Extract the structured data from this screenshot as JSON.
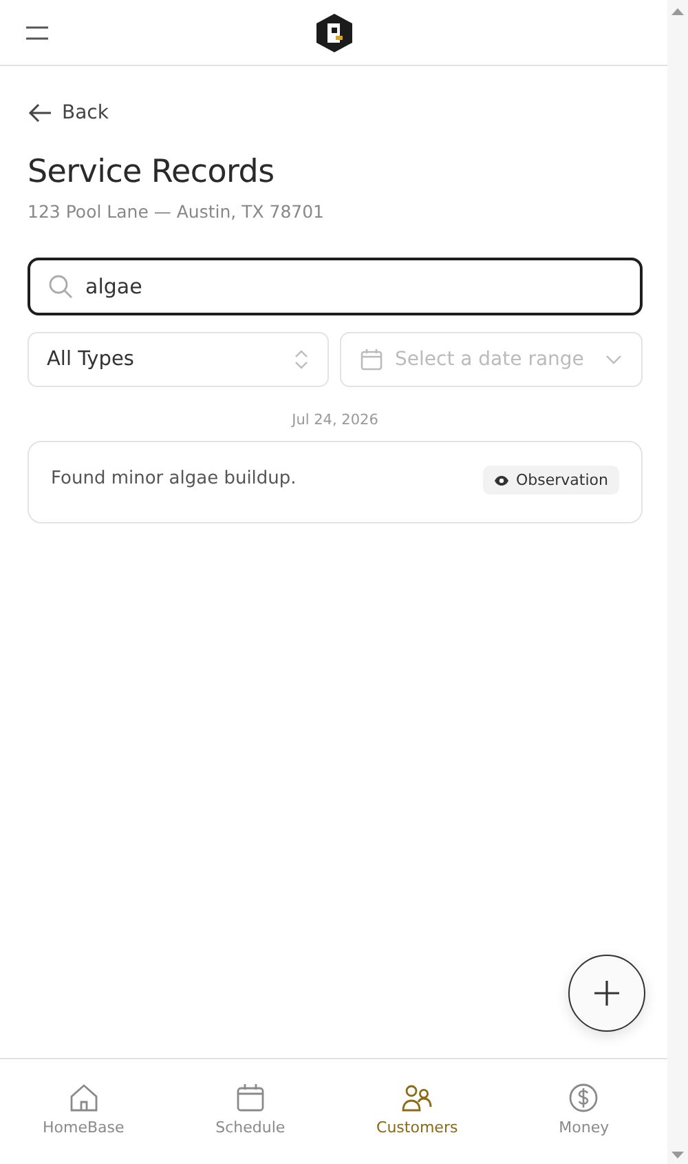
{
  "back": {
    "label": "Back"
  },
  "page": {
    "title": "Service Records",
    "address": "123 Pool Lane — Austin, TX 78701"
  },
  "search": {
    "value": "algae"
  },
  "filters": {
    "type": {
      "value": "All Types"
    },
    "date": {
      "placeholder": "Select a date range"
    }
  },
  "groups": [
    {
      "date": "Jul 24, 2026",
      "records": [
        {
          "text": "Found minor algae buildup.",
          "tag": "Observation"
        }
      ]
    }
  ],
  "nav": [
    {
      "label": "HomeBase",
      "selected": false
    },
    {
      "label": "Schedule",
      "selected": false
    },
    {
      "label": "Customers",
      "selected": true
    },
    {
      "label": "Money",
      "selected": false
    }
  ]
}
